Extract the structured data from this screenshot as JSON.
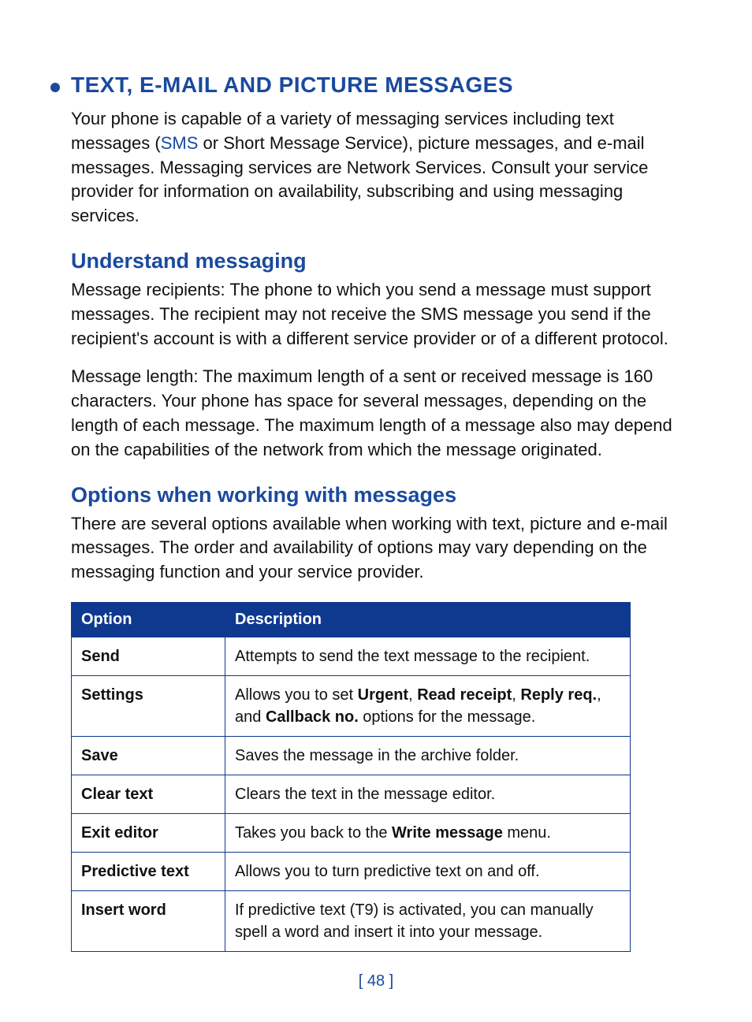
{
  "title": "TEXT, E-MAIL AND PICTURE MESSAGES",
  "intro": {
    "pre": "Your phone is capable of a variety of messaging services including text messages (",
    "link": "SMS",
    "post": " or Short Message Service), picture messages, and e-mail messages. Messaging services are Network Services. Consult your service provider for information on availability, subscribing and using messaging services."
  },
  "section1": {
    "heading": "Understand messaging",
    "p1": "Message recipients: The phone to which you send a message must support messages. The recipient may not receive the SMS message you send if the recipient's account is with a different service provider or of a different protocol.",
    "p2": "Message length: The maximum length of a sent or received message is 160 characters. Your phone has space for several messages, depending on the length of each message. The maximum length of a message also may depend on the capabilities of the network from which the message originated."
  },
  "section2": {
    "heading": "Options when working with messages",
    "p1": "There are several options available when working with text, picture and e-mail messages. The order and availability of options may vary depending on the messaging function and your service provider."
  },
  "table": {
    "h1": "Option",
    "h2": "Description",
    "rows": [
      {
        "opt": "Send",
        "desc": [
          {
            "t": "Attempts to send the text message to the recipient."
          }
        ]
      },
      {
        "opt": "Settings",
        "desc": [
          {
            "t": "Allows you to set "
          },
          {
            "b": "Urgent"
          },
          {
            "t": ", "
          },
          {
            "b": "Read receipt"
          },
          {
            "t": ", "
          },
          {
            "b": "Reply req."
          },
          {
            "t": ", and "
          },
          {
            "b": "Callback no."
          },
          {
            "t": " options for the message."
          }
        ]
      },
      {
        "opt": "Save",
        "desc": [
          {
            "t": "Saves the message in the archive folder."
          }
        ]
      },
      {
        "opt": "Clear text",
        "desc": [
          {
            "t": "Clears the text in the message editor."
          }
        ]
      },
      {
        "opt": "Exit editor",
        "desc": [
          {
            "t": "Takes you back to the "
          },
          {
            "b": "Write message"
          },
          {
            "t": " menu."
          }
        ]
      },
      {
        "opt": "Predictive text",
        "desc": [
          {
            "t": "Allows you to turn predictive text on and off."
          }
        ]
      },
      {
        "opt": "Insert word",
        "desc": [
          {
            "t": "If predictive text (T9) is activated, you can manually spell a word and insert it into your message."
          }
        ]
      }
    ]
  },
  "page_number": "[ 48 ]"
}
